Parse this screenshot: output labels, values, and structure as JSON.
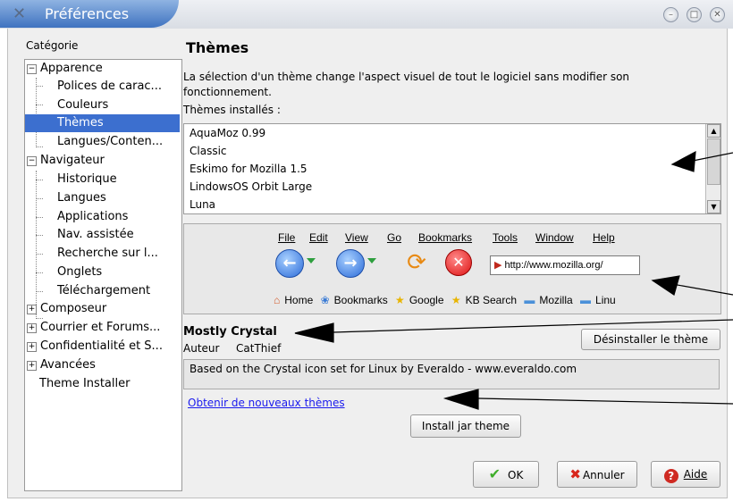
{
  "window": {
    "title": "Préférences",
    "app_icon": "x-logo-icon",
    "controls": [
      "minimize-icon",
      "maximize-icon",
      "close-icon"
    ]
  },
  "sidebar": {
    "label": "Catégorie",
    "items": [
      {
        "label": "Apparence",
        "expander": "⊟"
      },
      {
        "label": "Polices de carac..."
      },
      {
        "label": "Couleurs"
      },
      {
        "label": "Thèmes"
      },
      {
        "label": "Langues/Conten..."
      },
      {
        "label": "Navigateur",
        "expander": "⊟"
      },
      {
        "label": "Historique"
      },
      {
        "label": "Langues"
      },
      {
        "label": "Applications"
      },
      {
        "label": "Nav. assistée"
      },
      {
        "label": "Recherche sur l..."
      },
      {
        "label": "Onglets"
      },
      {
        "label": "Téléchargement"
      },
      {
        "label": "Composeur",
        "expander": "⊞"
      },
      {
        "label": "Courrier et Forums...",
        "expander": "⊞"
      },
      {
        "label": "Confidentialité et S...",
        "expander": "⊞"
      },
      {
        "label": "Avancées",
        "expander": "⊞"
      },
      {
        "label": "Theme Installer"
      }
    ],
    "selected": "Thèmes"
  },
  "main": {
    "heading": "Thèmes",
    "description": "La sélection d'un thème change l'aspect visuel de tout le logiciel sans modifier son fonctionnement.",
    "installed_label": "Thèmes installés :",
    "themes": [
      "AquaMoz 0.99",
      "Classic",
      "Eskimo for Mozilla 1.5",
      "LindowsOS Orbit Large",
      "Luna"
    ],
    "preview": {
      "menu": [
        "File",
        "Edit",
        "View",
        "Go",
        "Bookmarks",
        "Tools",
        "Window",
        "Help"
      ],
      "url": "http://www.mozilla.org/",
      "bookmarks": [
        "Home",
        "Bookmarks",
        "Google",
        "KB Search",
        "Mozilla",
        "Linu"
      ]
    },
    "theme_name": "Mostly Crystal",
    "author_label": "Auteur",
    "author": "CatThief",
    "uninstall_button": "Désinstaller le thème",
    "theme_description": "Based on the Crystal icon set for Linux by Everaldo - www.everaldo.com",
    "get_more_link": "Obtenir de nouveaux thèmes",
    "install_button": "Install jar theme"
  },
  "footer": {
    "ok": "OK",
    "cancel": "Annuler",
    "help": "Aide"
  }
}
